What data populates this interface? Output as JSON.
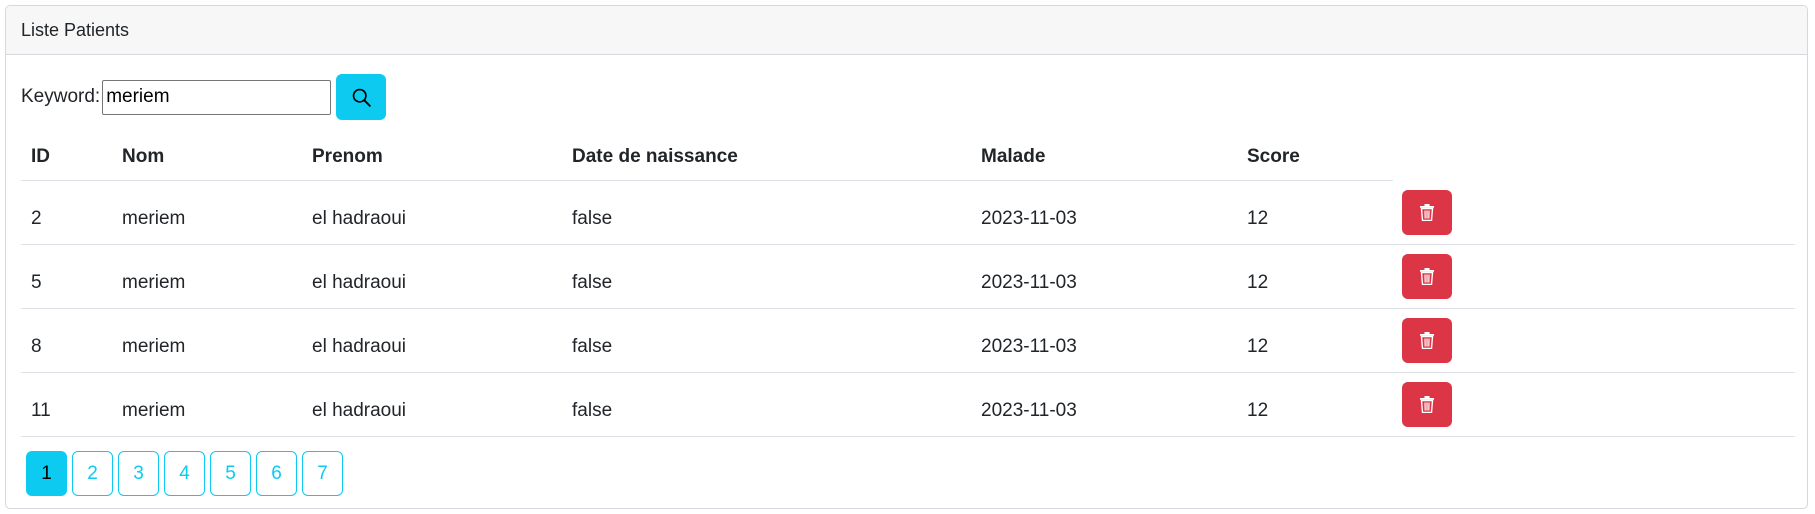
{
  "card": {
    "title": "Liste Patients"
  },
  "search": {
    "label": "Keyword:",
    "value": "meriem",
    "button_icon": "search-icon"
  },
  "table": {
    "headers": {
      "id": "ID",
      "nom": "Nom",
      "prenom": "Prenom",
      "date_naissance": "Date de naissance",
      "malade": "Malade",
      "score": "Score"
    },
    "rows": [
      {
        "id": "2",
        "nom": "meriem",
        "prenom": "el hadraoui",
        "date_naissance": "false",
        "malade": "2023-11-03",
        "score": "12",
        "action_icon": "trash-icon"
      },
      {
        "id": "5",
        "nom": "meriem",
        "prenom": "el hadraoui",
        "date_naissance": "false",
        "malade": "2023-11-03",
        "score": "12",
        "action_icon": "trash-icon"
      },
      {
        "id": "8",
        "nom": "meriem",
        "prenom": "el hadraoui",
        "date_naissance": "false",
        "malade": "2023-11-03",
        "score": "12",
        "action_icon": "trash-icon"
      },
      {
        "id": "11",
        "nom": "meriem",
        "prenom": "el hadraoui",
        "date_naissance": "false",
        "malade": "2023-11-03",
        "score": "12",
        "action_icon": "trash-icon"
      }
    ]
  },
  "pagination": {
    "pages": [
      "1",
      "2",
      "3",
      "4",
      "5",
      "6",
      "7"
    ],
    "active_page": "1"
  },
  "colors": {
    "info": "#0dcaf0",
    "danger": "#dc3545",
    "header_bg": "#f7f7f7",
    "border": "#dee2e6"
  }
}
